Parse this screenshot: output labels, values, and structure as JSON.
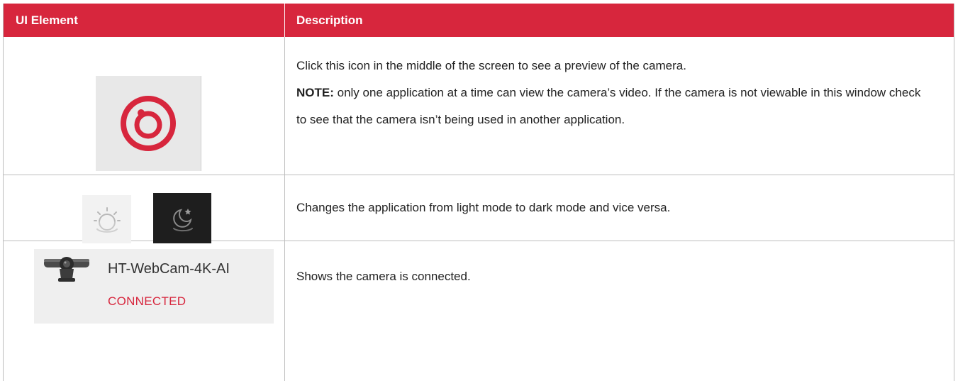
{
  "header": {
    "col1": "UI Element",
    "col2": "Description"
  },
  "rows": [
    {
      "icon": "camera-preview-target-icon",
      "line1": "Click this icon in the middle of the screen to see a preview of the camera.",
      "note_label": "NOTE:",
      "note_text": " only one application at a time can view the camera’s video. If the camera is not viewable in this window check to see that the camera isn’t being used in another application."
    },
    {
      "icons": [
        "sun-icon",
        "moon-star-icon"
      ],
      "text": "Changes the application from light mode to dark mode and vice versa."
    },
    {
      "icon": "webcam-icon",
      "device_name": "HT-WebCam-4K-AI",
      "status": "CONNECTED",
      "text": "Shows the camera is connected."
    }
  ],
  "colors": {
    "header_bg": "#d7263d",
    "accent_red": "#d7263d",
    "dark_tile": "#1e1e1e"
  }
}
